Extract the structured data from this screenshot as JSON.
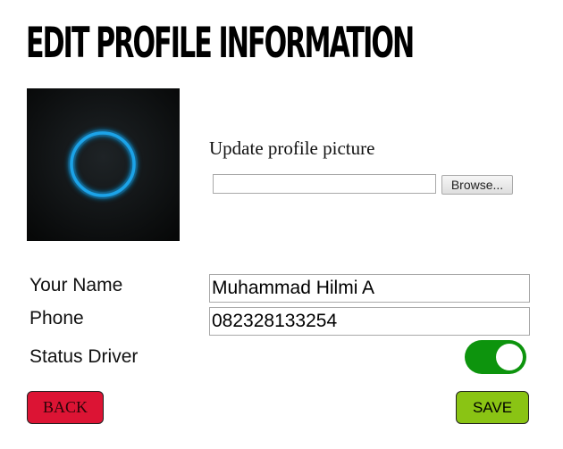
{
  "header": {
    "title": "Edit Profile Information"
  },
  "avatar": {
    "icon": "glowing-ring-avatar",
    "ring_color": "#1aa3e8"
  },
  "upload": {
    "label": "Update profile picture",
    "file_value": "",
    "browse_label": "Browse..."
  },
  "form": {
    "name_label": "Your Name",
    "name_value": "Muhammad Hilmi A",
    "phone_label": "Phone",
    "phone_value": "082328133254",
    "status_label": "Status Driver",
    "status_on": true,
    "toggle_color": "#0d940d"
  },
  "actions": {
    "back_label": "BACK",
    "back_color": "#dc1434",
    "save_label": "SAVE",
    "save_color": "#8ac414"
  }
}
